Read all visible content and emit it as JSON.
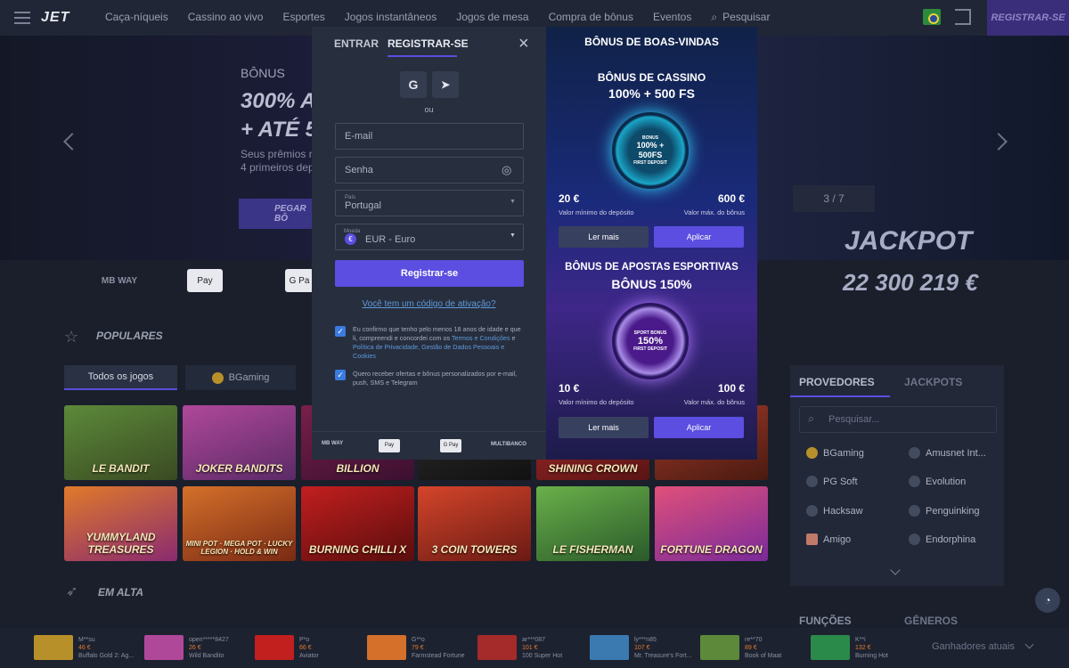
{
  "header": {
    "logo": "JET",
    "nav": [
      "Caça-níqueis",
      "Cassino ao vivo",
      "Esportes",
      "Jogos instantâneos",
      "Jogos de mesa",
      "Compra de bônus",
      "Eventos",
      "Pesquisar"
    ],
    "register": "REGISTRAR-SE"
  },
  "hero": {
    "label": "BÔNUS",
    "headline1": "300% A",
    "headline2": "+ ATÉ 5",
    "desc1": "Seus prêmios n",
    "desc2": "4 primeiros dep",
    "cta": "PEGAR BÔ",
    "pager": "3 / 7",
    "jackpot_label": "JACKPOT",
    "jackpot_value": "22 300 219 €"
  },
  "payments": {
    "mbway": "MB WAY",
    "applepay": "Pay",
    "gpay": "G Pa"
  },
  "populares": {
    "title": "POPULARES",
    "tabs": [
      "Todos os jogos",
      "BGaming"
    ],
    "games_row1": [
      "LE BANDIT",
      "JOKER BANDITS",
      "BILLION",
      "",
      "SHINING CROWN",
      ""
    ],
    "games_row2": [
      "YUMMYLAND TREASURES",
      "MINI POT · MEGA POT · LUCKY LEGION · HOLD & WIN",
      "BURNING CHILLI X",
      "3 COIN TOWERS",
      "LE FISHERMAN",
      "FORTUNE DRAGON"
    ]
  },
  "em_alta": "EM ALTA",
  "providers": {
    "tab1": "PROVEDORES",
    "tab2": "JACKPOTS",
    "search_placeholder": "Pesquisar...",
    "left": [
      "BGaming",
      "PG Soft",
      "Hacksaw",
      "Amigo"
    ],
    "right": [
      "Amusnet Int...",
      "Evolution",
      "Penguinking",
      "Endorphina"
    ],
    "below1": "FUNÇÕES",
    "below2": "GÊNEROS"
  },
  "modal": {
    "tab_login": "ENTRAR",
    "tab_register": "REGISTRAR-SE",
    "sso_google": "G",
    "sso_telegram": "➤",
    "or": "ou",
    "email_placeholder": "E-mail",
    "password_placeholder": "Senha",
    "country_label": "País",
    "country_value": "Portugal",
    "currency_label": "Moeda",
    "currency_value": "EUR - Euro",
    "submit": "Registrar-se",
    "activation_link": "Você tem um código de ativação?",
    "consent1_a": "Eu confirmo que tenho pelo menos 18 anos de idade e que li, compreendi e concordei com os ",
    "consent1_link1": "Termos e Condições",
    "consent1_b": " e ",
    "consent1_link2": "Política de Privacidade, Gestão de Dados Pessoais e Cookies",
    "consent2": "Quero receber ofertas e bônus personalizados por e-mail, push, SMS e Telegram",
    "footer_payments": [
      "MB WAY",
      "Pay",
      "G Pay",
      "MULTIBANCO"
    ]
  },
  "bonus": {
    "title": "BÔNUS DE BOAS-VINDAS",
    "casino_title": "BÔNUS DE CASSINO",
    "casino_sub": "100% + 500 FS",
    "casino_ring_top": "BONUS",
    "casino_ring": "100% + 500FS",
    "casino_ring_bottom": "FIRST DEPOSIT",
    "casino_min": "20 €",
    "casino_min_cap": "Valor mínimo do depósito",
    "casino_max": "600 €",
    "casino_max_cap": "Valor máx. do bônus",
    "sport_title": "BÔNUS DE APOSTAS ESPORTIVAS",
    "sport_sub": "BÔNUS 150%",
    "sport_ring_top": "SPORT BONUS",
    "sport_ring": "150%",
    "sport_ring_bottom": "FIRST DEPOSIT",
    "sport_min": "10 €",
    "sport_min_cap": "Valor mínimo do depósito",
    "sport_max": "100 €",
    "sport_max_cap": "Valor máx. do bônus",
    "read_more": "Ler mais",
    "apply": "Aplicar"
  },
  "ticker": {
    "items": [
      {
        "user": "M**su",
        "amount": "46 €",
        "game": "Buffalo Gold 2: Ag..."
      },
      {
        "user": "open*****8427",
        "amount": "26 €",
        "game": "Wild Bandito"
      },
      {
        "user": "P*o",
        "amount": "66 €",
        "game": "Aviator"
      },
      {
        "user": "G**o",
        "amount": "79 €",
        "game": "Farmstead Fortune"
      },
      {
        "user": "ar***087",
        "amount": "101 €",
        "game": "100 Super Hot"
      },
      {
        "user": "ly***n85",
        "amount": "107 €",
        "game": "Mr. Treasure's Fort..."
      },
      {
        "user": "re**70",
        "amount": "89 €",
        "game": "Book of Maat"
      },
      {
        "user": "K**i",
        "amount": "132 €",
        "game": "Burning Hot"
      }
    ],
    "label": "Ganhadores atuais"
  }
}
